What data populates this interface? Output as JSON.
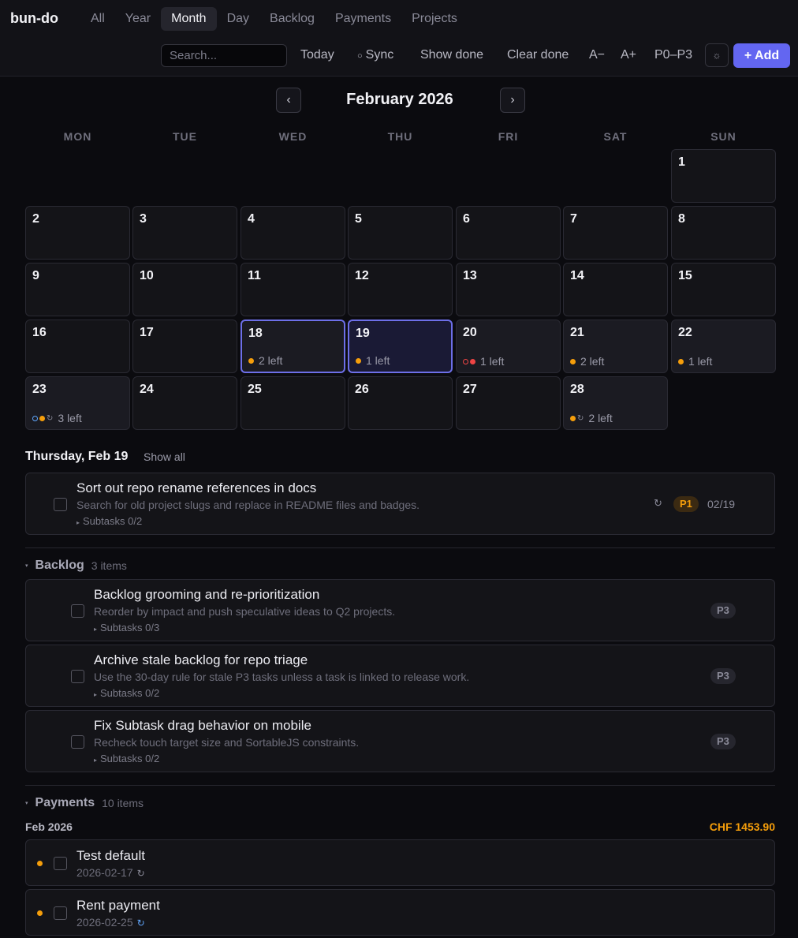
{
  "app": {
    "brand": "bun-do"
  },
  "nav": {
    "tabs": [
      "All",
      "Year",
      "Month",
      "Day",
      "Backlog",
      "Payments",
      "Projects"
    ],
    "active": "Month"
  },
  "toolbar": {
    "search_placeholder": "Search...",
    "today": "Today",
    "sync": "Sync",
    "show_done": "Show done",
    "clear_done": "Clear done",
    "font_smaller": "A−",
    "font_larger": "A+",
    "priority_filter": "P0–P3",
    "theme_icon": "☼",
    "add": "+ Add"
  },
  "calendar": {
    "title": "February 2026",
    "prev": "‹",
    "next": "›",
    "weekdays": [
      "MON",
      "TUE",
      "WED",
      "THU",
      "FRI",
      "SAT",
      "SUN"
    ],
    "days": [
      {
        "n": "1",
        "state": "",
        "info": "",
        "markers": []
      },
      {
        "n": "2",
        "state": "",
        "info": "",
        "markers": []
      },
      {
        "n": "3",
        "state": "",
        "info": "",
        "markers": []
      },
      {
        "n": "4",
        "state": "",
        "info": "",
        "markers": []
      },
      {
        "n": "5",
        "state": "",
        "info": "",
        "markers": []
      },
      {
        "n": "6",
        "state": "",
        "info": "",
        "markers": []
      },
      {
        "n": "7",
        "state": "",
        "info": "",
        "markers": []
      },
      {
        "n": "8",
        "state": "",
        "info": "",
        "markers": []
      },
      {
        "n": "9",
        "state": "",
        "info": "",
        "markers": []
      },
      {
        "n": "10",
        "state": "",
        "info": "",
        "markers": []
      },
      {
        "n": "11",
        "state": "",
        "info": "",
        "markers": []
      },
      {
        "n": "12",
        "state": "",
        "info": "",
        "markers": []
      },
      {
        "n": "13",
        "state": "",
        "info": "",
        "markers": []
      },
      {
        "n": "14",
        "state": "",
        "info": "",
        "markers": []
      },
      {
        "n": "15",
        "state": "",
        "info": "",
        "markers": []
      },
      {
        "n": "16",
        "state": "",
        "info": "",
        "markers": []
      },
      {
        "n": "17",
        "state": "",
        "info": "",
        "markers": []
      },
      {
        "n": "18",
        "state": "sel",
        "info": "2 left",
        "markers": [
          "orange"
        ]
      },
      {
        "n": "19",
        "state": "today",
        "info": "1 left",
        "markers": [
          "orange"
        ]
      },
      {
        "n": "20",
        "state": "has",
        "info": "1 left",
        "markers": [
          "ring-red",
          "red"
        ]
      },
      {
        "n": "21",
        "state": "has",
        "info": "2 left",
        "markers": [
          "orange"
        ]
      },
      {
        "n": "22",
        "state": "has",
        "info": "1 left",
        "markers": [
          "orange"
        ]
      },
      {
        "n": "23",
        "state": "has",
        "info": "3 left",
        "markers": [
          "ring-blue",
          "orange",
          "recur"
        ]
      },
      {
        "n": "24",
        "state": "",
        "info": "",
        "markers": []
      },
      {
        "n": "25",
        "state": "",
        "info": "",
        "markers": []
      },
      {
        "n": "26",
        "state": "",
        "info": "",
        "markers": []
      },
      {
        "n": "27",
        "state": "",
        "info": "",
        "markers": []
      },
      {
        "n": "28",
        "state": "has",
        "info": "2 left",
        "markers": [
          "orange",
          "recur"
        ]
      }
    ]
  },
  "day_view": {
    "title": "Thursday, Feb 19",
    "show_all": "Show all",
    "task": {
      "title": "Sort out repo rename references in docs",
      "desc": "Search for old project slugs and replace in README files and badges.",
      "subtasks": "Subtasks 0/2",
      "priority": "P1",
      "due": "02/19",
      "recur_icon": "↻"
    }
  },
  "backlog": {
    "name": "Backlog",
    "count": "3 items",
    "items": [
      {
        "title": "Backlog grooming and re-prioritization",
        "desc": "Reorder by impact and push speculative ideas to Q2 projects.",
        "subtasks": "Subtasks 0/3",
        "priority": "P3"
      },
      {
        "title": "Archive stale backlog for repo triage",
        "desc": "Use the 30-day rule for stale P3 tasks unless a task is linked to release work.",
        "subtasks": "Subtasks 0/2",
        "priority": "P3"
      },
      {
        "title": "Fix Subtask drag behavior on mobile",
        "desc": "Recheck touch target size and SortableJS constraints.",
        "subtasks": "Subtasks 0/2",
        "priority": "P3"
      }
    ]
  },
  "payments": {
    "name": "Payments",
    "count": "10 items",
    "month": "Feb 2026",
    "total": "CHF 1453.90",
    "items": [
      {
        "title": "Test default",
        "date": "2026-02-17",
        "recur_color": "#8a8a98"
      },
      {
        "title": "Rent payment",
        "date": "2026-02-25",
        "recur_color": "#60a5fa"
      }
    ]
  },
  "colors": {
    "accent": "#6366f1",
    "warning": "#f59e0b",
    "danger": "#ef4444",
    "info": "#60a5fa"
  }
}
